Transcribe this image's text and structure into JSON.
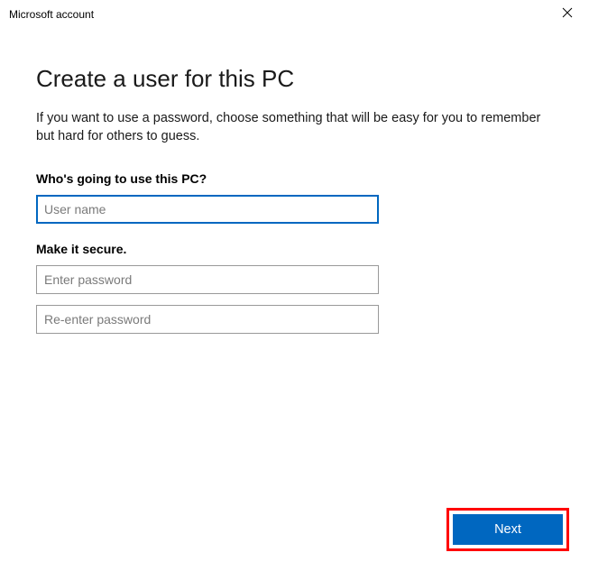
{
  "window": {
    "title": "Microsoft account"
  },
  "header": {
    "title": "Create a user for this PC",
    "description": "If you want to use a password, choose something that will be easy for you to remember but hard for others to guess."
  },
  "sections": {
    "user": {
      "label": "Who's going to use this PC?",
      "username_placeholder": "User name",
      "username_value": ""
    },
    "secure": {
      "label": "Make it secure.",
      "password_placeholder": "Enter password",
      "password_value": "",
      "confirm_placeholder": "Re-enter password",
      "confirm_value": ""
    }
  },
  "footer": {
    "next_label": "Next"
  }
}
